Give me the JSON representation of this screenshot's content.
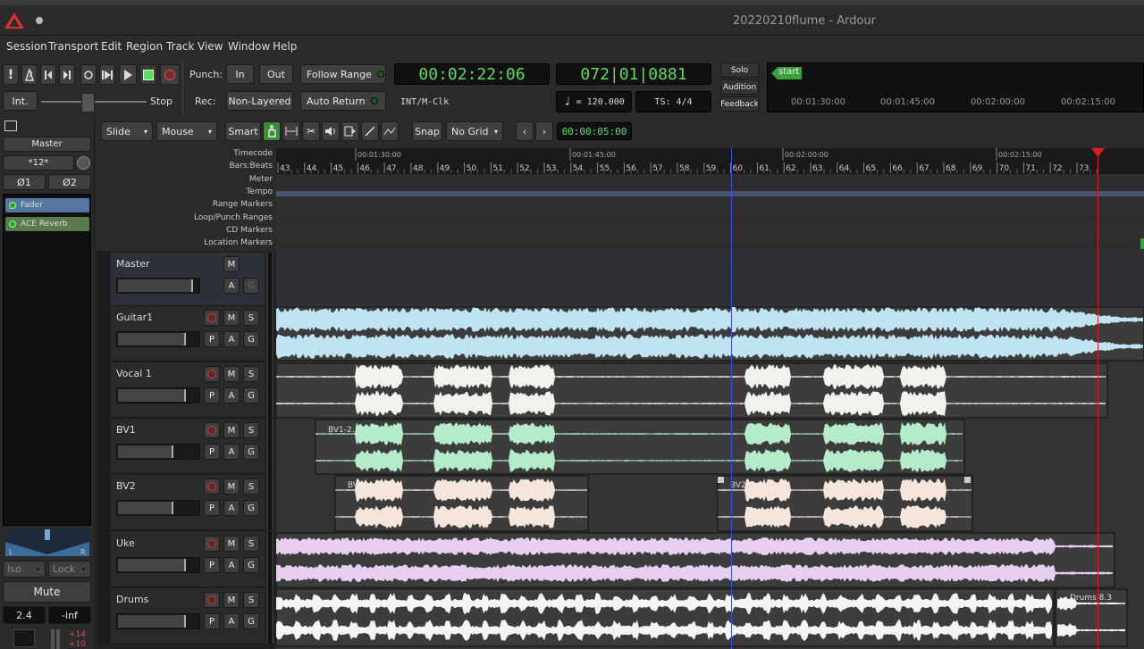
{
  "window": {
    "title": "20220210flume - Ardour"
  },
  "menu": [
    "Session",
    "Transport",
    "Edit",
    "Region",
    "Track",
    "View",
    "Window",
    "Help"
  ],
  "transport": {
    "punch_label": "Punch:",
    "in": "In",
    "out": "Out",
    "rec_label": "Rec:",
    "non_layered": "Non-Layered",
    "follow_range": "Follow Range",
    "auto_return": "Auto Return",
    "int": "Int.",
    "stop": "Stop",
    "timecode": "00:02:22:06",
    "bbt": "072|01|0881",
    "clock_source": "INT/M-Clk",
    "tempo": "= 120.000",
    "ts": "TS: 4/4",
    "solo": "Solo",
    "audition": "Audition",
    "feedback": "Feedback"
  },
  "minitimeline": {
    "marker": "start",
    "times": [
      "00:01:30:00",
      "00:01:45:00",
      "00:02:00:00",
      "00:02:15:00"
    ]
  },
  "edit_toolbar": {
    "mode": "Slide",
    "mouse": "Mouse",
    "smart": "Smart",
    "snap": "Snap",
    "grid": "No Grid",
    "nudge": "00:00:05:00"
  },
  "rulers": [
    "Timecode",
    "Bars:Beats",
    "Meter",
    "Tempo",
    "Range Markers",
    "Loop/Punch Ranges",
    "CD Markers",
    "Location Markers"
  ],
  "ruler_timecodes": [
    "00:01:30:00",
    "00:01:45:00",
    "00:02:00:00",
    "00:02:15:00"
  ],
  "bars": [
    "43",
    "44",
    "45",
    "46",
    "47",
    "48",
    "49",
    "50",
    "51",
    "52",
    "53",
    "54",
    "55",
    "56",
    "57",
    "58",
    "59",
    "60",
    "61",
    "62",
    "63",
    "64",
    "65",
    "66",
    "67",
    "68",
    "69",
    "70",
    "71",
    "72",
    "73"
  ],
  "strip": {
    "name": "Master",
    "input": "*12*",
    "phase1": "Ø1",
    "phase2": "Ø2",
    "plugins": [
      "Fader",
      "ACE Reverb"
    ],
    "pan_l": "L",
    "pan_r": "R",
    "iso": "Iso",
    "lock": "Lock",
    "mute": "Mute",
    "gain": "2.4",
    "peak": "-inf",
    "meter_top": "+14",
    "meter_2": "+10"
  },
  "tracks": [
    {
      "name": "Master",
      "m": "M",
      "a": "A",
      "g": "G",
      "color": "#34373d"
    },
    {
      "name": "Guitar1",
      "m": "M",
      "s": "S",
      "p": "P",
      "a": "A",
      "g": "G",
      "color": "#bfe3f0"
    },
    {
      "name": "Vocal 1",
      "m": "M",
      "s": "S",
      "p": "P",
      "a": "A",
      "g": "G",
      "color": "#f2f1ec"
    },
    {
      "name": "BV1",
      "m": "M",
      "s": "S",
      "p": "P",
      "a": "A",
      "g": "G",
      "color": "#b4ecc9",
      "region": "BV1-2.1"
    },
    {
      "name": "BV2",
      "m": "M",
      "s": "S",
      "p": "P",
      "a": "A",
      "g": "G",
      "color": "#f6e5da",
      "region": "BV",
      "region2": "BV2.1"
    },
    {
      "name": "Uke",
      "m": "M",
      "s": "S",
      "p": "P",
      "a": "A",
      "g": "G",
      "color": "#e7cff0"
    },
    {
      "name": "Drums",
      "m": "M",
      "s": "S",
      "p": "P",
      "a": "A",
      "g": "G",
      "color": "#f4f4f4",
      "region": "Drums 8.3"
    }
  ]
}
